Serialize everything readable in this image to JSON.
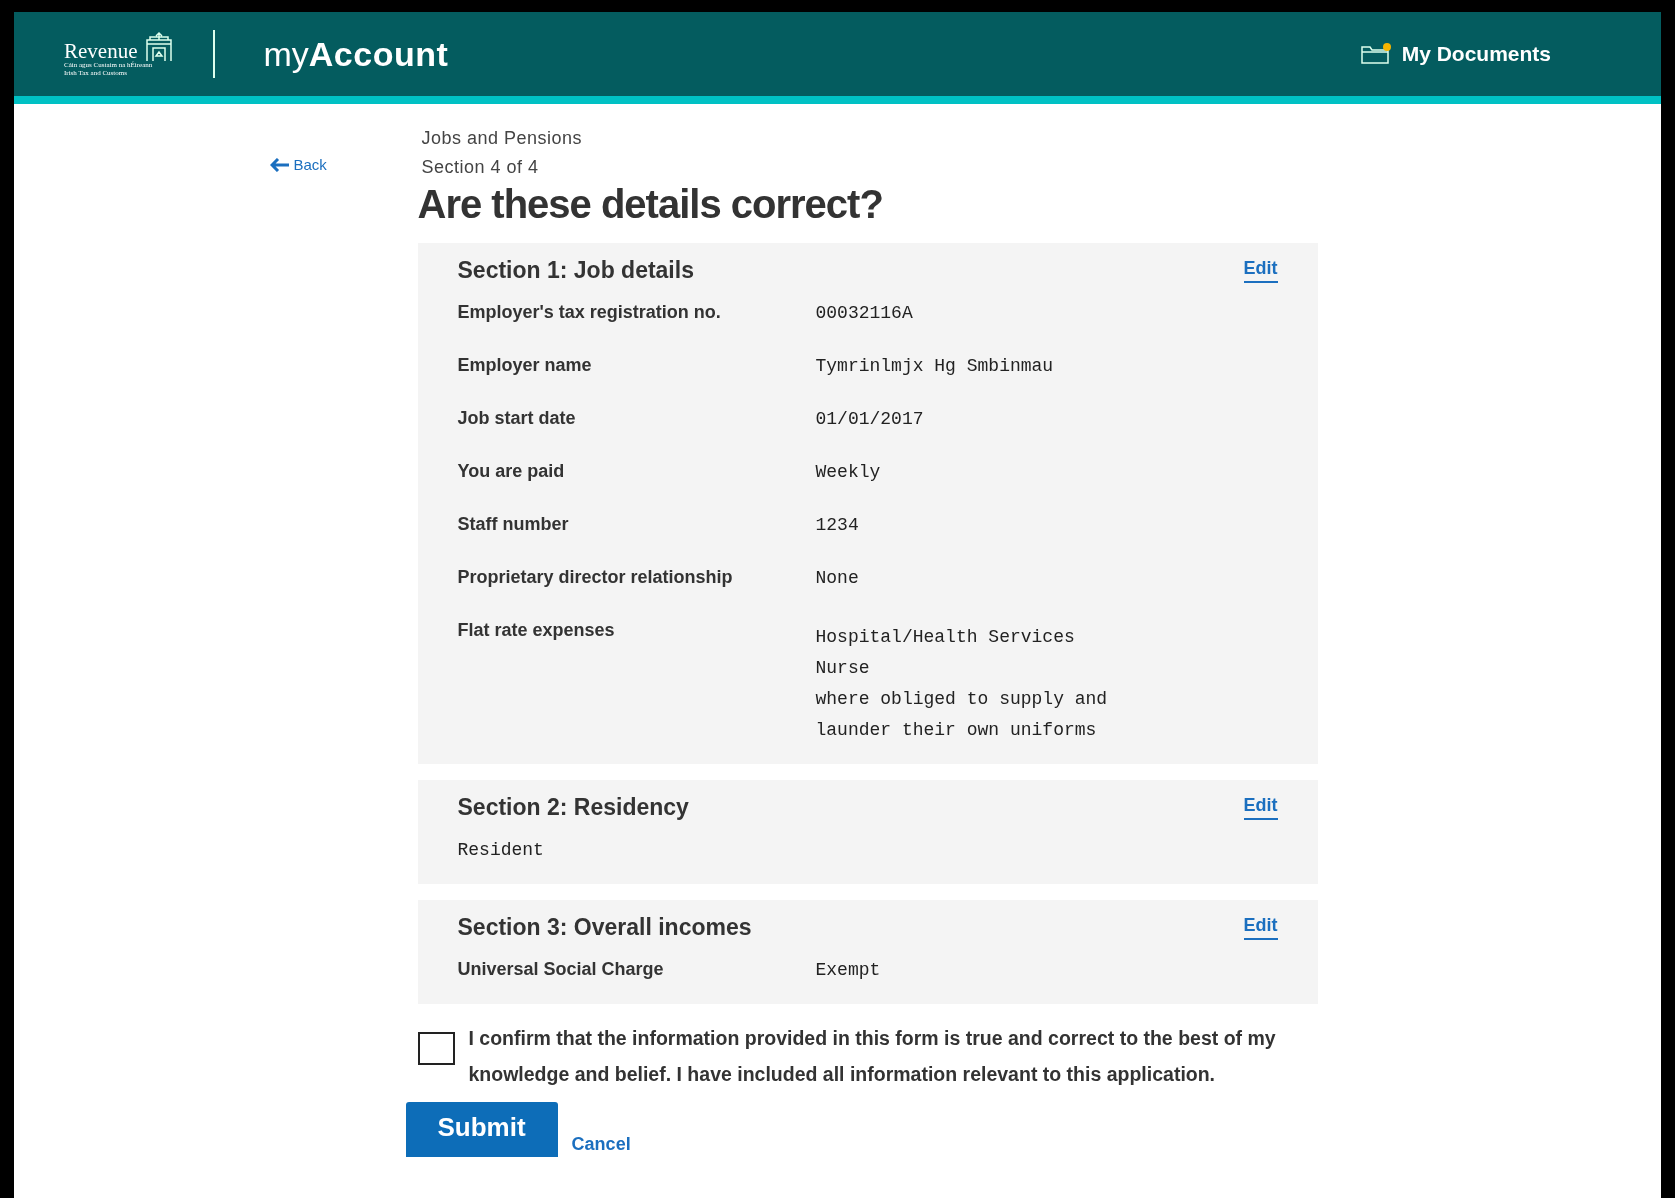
{
  "header": {
    "logo": {
      "name": "Revenue",
      "tagline_1": "Cáin agus Custaim na hÉireann",
      "tagline_2": "Irish Tax and Customs"
    },
    "product": {
      "prefix": "my",
      "name": "Account"
    },
    "documents_link": "My Documents"
  },
  "breadcrumb": {
    "back": "Back",
    "category": "Jobs and Pensions",
    "progress": "Section 4 of 4"
  },
  "title": "Are these details correct?",
  "sections": [
    {
      "title": "Section 1: Job details",
      "edit": "Edit",
      "rows": [
        {
          "label": "Employer's tax registration no.",
          "value": [
            "00032116A"
          ]
        },
        {
          "label": "Employer name",
          "value": [
            "Tymrinlmjx Hg Smbinmau"
          ]
        },
        {
          "label": "Job start date",
          "value": [
            "01/01/2017"
          ]
        },
        {
          "label": "You are paid",
          "value": [
            "Weekly"
          ]
        },
        {
          "label": "Staff number",
          "value": [
            "1234"
          ]
        },
        {
          "label": "Proprietary director relationship",
          "value": [
            "None"
          ]
        },
        {
          "label": "Flat rate expenses",
          "value": [
            "Hospital/Health Services",
            "Nurse",
            "where obliged to supply and",
            "launder their own uniforms"
          ]
        }
      ]
    },
    {
      "title": "Section 2: Residency",
      "edit": "Edit",
      "rows": [
        {
          "value": [
            "Resident"
          ]
        }
      ]
    },
    {
      "title": "Section 3: Overall incomes",
      "edit": "Edit",
      "rows": [
        {
          "label": "Universal Social Charge",
          "value": [
            "Exempt"
          ]
        }
      ]
    }
  ],
  "confirmation": {
    "text": "I confirm that the information provided in this form is true and correct to the best of my knowledge and belief. I have included all information relevant to this application.",
    "checked": false
  },
  "actions": {
    "submit": "Submit",
    "cancel": "Cancel"
  }
}
